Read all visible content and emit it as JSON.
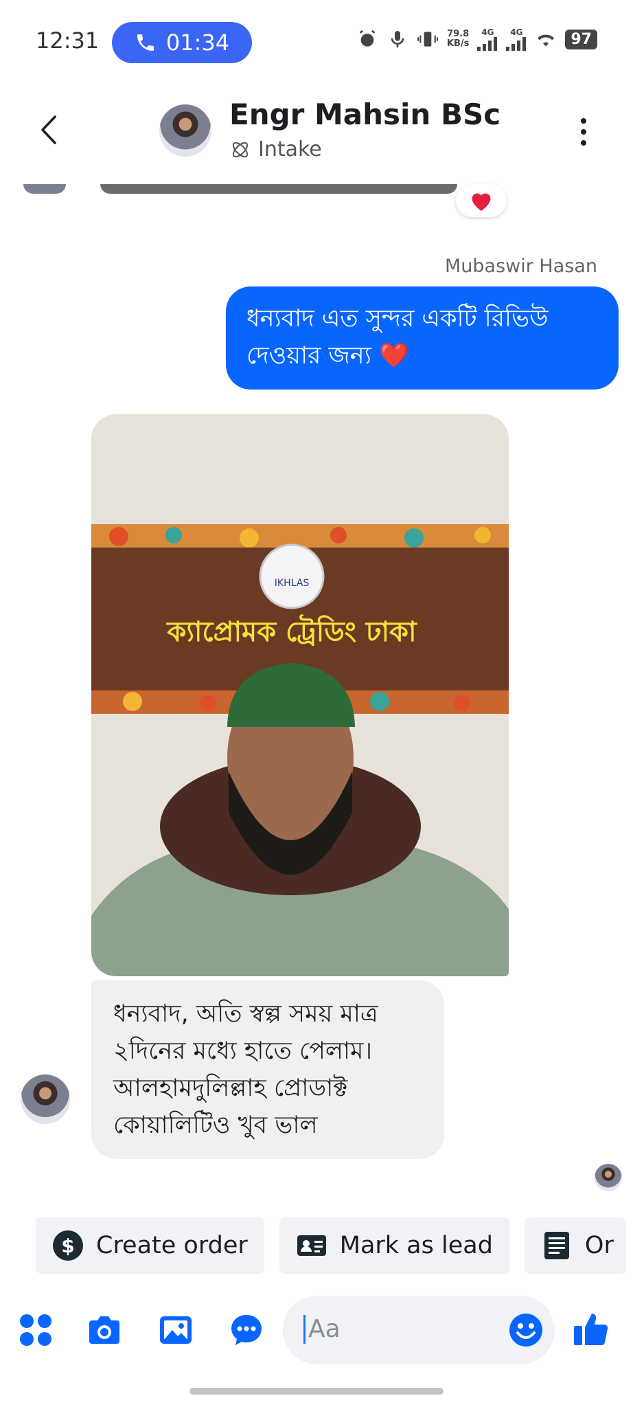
{
  "status_bar": {
    "time": "12:31",
    "call_timer": "01:34",
    "net_speed_value": "79.8",
    "net_speed_unit": "KB/s",
    "network1": "4G",
    "network2": "4G",
    "battery": "97"
  },
  "header": {
    "contact_name": "Engr Mahsin BSc",
    "subtitle": "Intake"
  },
  "thread": {
    "reaction_emoji": "❤️",
    "sender_name": "Mubaswir Hasan",
    "outgoing_message": "ধন্যবাদ এত সুন্দর একটি রিভিউ দেওয়ার জন্য ❤️",
    "photo_sign_text": "ক্যাপ্রোমক ট্রেডিং ঢাকা",
    "photo_logo_text": "IKHLAS",
    "incoming_message": "ধন্যবাদ, অতি স্বল্প সময় মাত্র ২দিনের মধ্যে হাতে পেলাম। আলহামদুলিল্লাহ প্রোডাক্ট কোয়ালিটিও খুব ভাল"
  },
  "quick_actions": [
    {
      "label": "Create order",
      "icon": "dollar-icon"
    },
    {
      "label": "Mark as lead",
      "icon": "id-card-icon"
    },
    {
      "label": "Or",
      "icon": "document-icon"
    }
  ],
  "composer": {
    "placeholder": "Aa"
  },
  "colors": {
    "accent": "#0866ff",
    "call_pill": "#3b65f5",
    "incoming_bubble": "#f0f0f0",
    "chip_bg": "#f0f2f5",
    "heart": "#e41e3f"
  }
}
